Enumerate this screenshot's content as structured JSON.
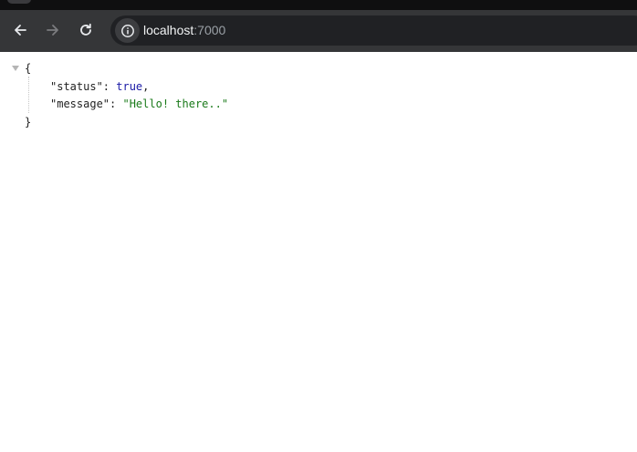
{
  "browser": {
    "url_host": "localhost",
    "url_port": ":7000",
    "icons": {
      "back": "arrow-left-icon",
      "forward": "arrow-right-icon",
      "reload": "reload-icon",
      "site_info": "info-icon"
    }
  },
  "json_view": {
    "open_brace": "{",
    "close_brace": "}",
    "entries": [
      {
        "key": "\"status\"",
        "separator": ": ",
        "value": "true",
        "trailing": ","
      },
      {
        "key": "\"message\"",
        "separator": ": ",
        "value": "\"Hello! there..\"",
        "trailing": ""
      }
    ]
  },
  "colors": {
    "toolbar_bg": "#353638",
    "omnibox_bg": "#202124",
    "json_string": "#1a7a1a",
    "json_boolean": "#1a1aa6"
  }
}
